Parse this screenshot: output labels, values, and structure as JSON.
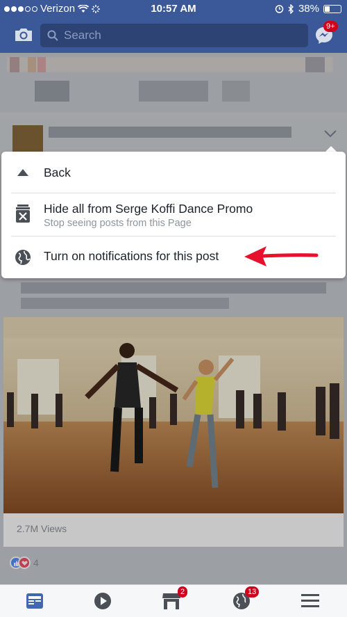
{
  "status": {
    "carrier": "Verizon",
    "time": "10:57 AM",
    "battery": "38%",
    "battery_level": 0.38
  },
  "nav": {
    "search_placeholder": "Search",
    "messenger_badge": "9+"
  },
  "menu": {
    "items": [
      {
        "title": "Back",
        "subtitle": ""
      },
      {
        "title": "Hide all from Serge Koffi Dance Promo",
        "subtitle": "Stop seeing posts from this Page"
      },
      {
        "title": "Turn on notifications for this post",
        "subtitle": ""
      }
    ]
  },
  "post": {
    "views": "2.7M Views",
    "reaction_count": "4"
  },
  "tabs": {
    "marketplace_badge": "2",
    "notifications_badge": "13"
  },
  "colors": {
    "brand": "#3b5998",
    "badge": "#d0021b",
    "arrow": "#e8112d"
  }
}
